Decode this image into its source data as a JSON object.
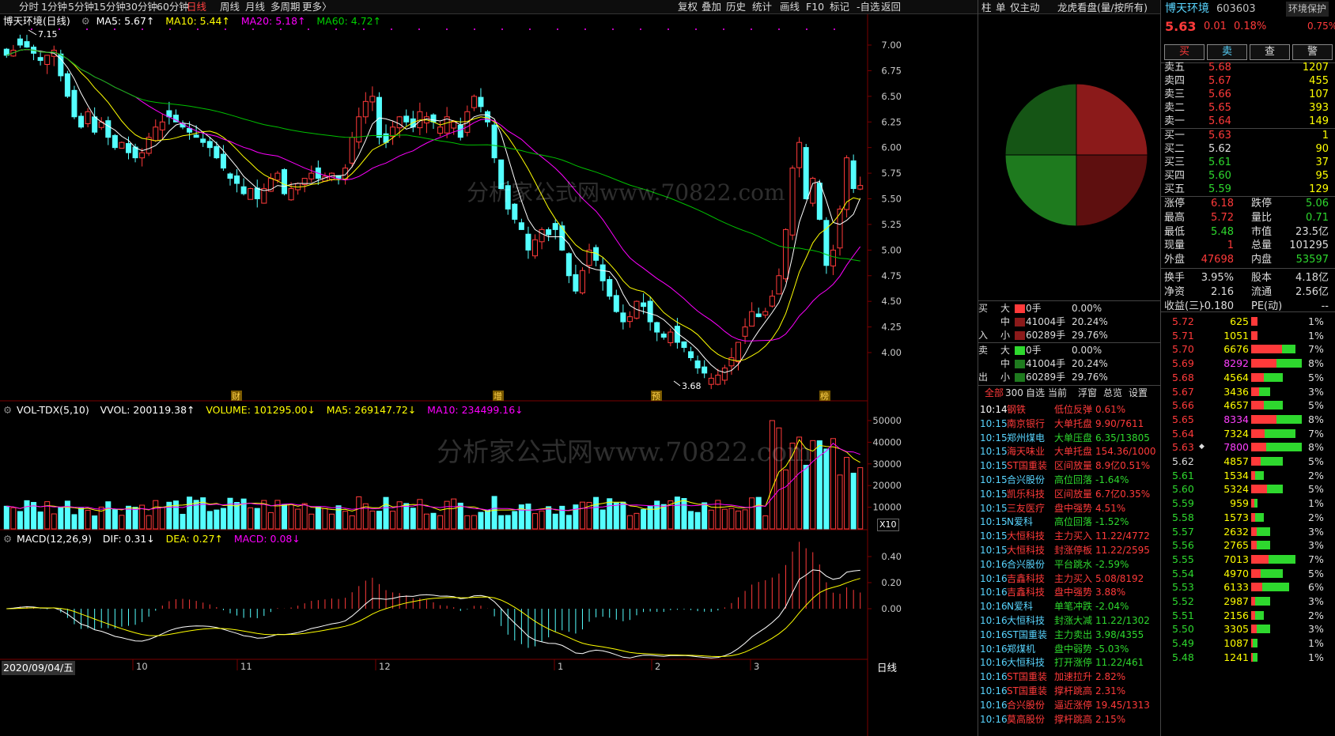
{
  "colors": {
    "up": "#ff3a3a",
    "down": "#54ffff",
    "ma5": "#ffffff",
    "ma10": "#ffff00",
    "ma20": "#ff00ff",
    "ma60": "#00c000",
    "pie_red": "#8b1a1a",
    "pie_green": "#1e7a1e"
  },
  "timeframe_tabs": [
    "分时",
    "1分钟",
    "5分钟",
    "15分钟",
    "30分钟",
    "60分钟",
    "日线",
    "周线",
    "月线",
    "多周期",
    "更多〉"
  ],
  "active_tab": "日线",
  "toolbar": [
    "复权",
    "叠加",
    "历史",
    "统计",
    "画线",
    "F10",
    "标记",
    "-自选",
    "返回"
  ],
  "mid_tabs": [
    "柱",
    "单",
    "仅主动"
  ],
  "dragon_tiger": "龙虎看盘(量/按所有)",
  "price_header": {
    "name": "博天环境(日线)",
    "ma5": "MA5: 5.67↑",
    "ma10": "MA10: 5.44↑",
    "ma20": "MA20: 5.18↑",
    "ma60": "MA60: 4.72↑"
  },
  "high_marker": "7.15",
  "low_marker": "3.68",
  "price_axis": [
    "7.00",
    "6.75",
    "6.50",
    "6.25",
    "6.00",
    "5.75",
    "5.50",
    "5.25",
    "5.00",
    "4.75",
    "4.50",
    "4.25",
    "4.00"
  ],
  "event_markers": [
    "财",
    "增",
    "预",
    "榜"
  ],
  "vol_header": {
    "name": "VOL-TDX(5,10)",
    "vvol": "VVOL: 200119.38↑",
    "volume": "VOLUME: 101295.00↓",
    "ma5": "MA5: 269147.72↓",
    "ma10": "MA10: 234499.16↓"
  },
  "vol_axis": [
    "50000",
    "40000",
    "30000",
    "20000",
    "10000"
  ],
  "vol_unit": "X10",
  "macd_header": {
    "name": "MACD(12,26,9)",
    "dif": "DIF: 0.31↓",
    "dea": "DEA: 0.27↑",
    "macd": "MACD: 0.08↓"
  },
  "macd_axis": [
    "0.40",
    "0.20",
    "0.00"
  ],
  "date_axis": {
    "first": "2020/09/04/五",
    "labels": [
      "10",
      "11",
      "12",
      "1",
      "2",
      "3"
    ]
  },
  "period_label": "日线",
  "watermark": "分析家公式网www.70822.com",
  "stock": {
    "name": "博天环境",
    "code": "603603",
    "tag": "环境保护",
    "price": "5.63",
    "change": "0.01",
    "pct": "0.18%",
    "turnover_tag": "0.75%"
  },
  "action_buttons": [
    "买",
    "卖",
    "查",
    "警"
  ],
  "asks": [
    {
      "label": "卖五",
      "price": "5.68",
      "vol": "1207"
    },
    {
      "label": "卖四",
      "price": "5.67",
      "vol": "455"
    },
    {
      "label": "卖三",
      "price": "5.66",
      "vol": "107"
    },
    {
      "label": "卖二",
      "price": "5.65",
      "vol": "393"
    },
    {
      "label": "卖一",
      "price": "5.64",
      "vol": "149"
    }
  ],
  "bids": [
    {
      "label": "买一",
      "price": "5.63",
      "vol": "1"
    },
    {
      "label": "买二",
      "price": "5.62",
      "vol": "90"
    },
    {
      "label": "买三",
      "price": "5.61",
      "vol": "37"
    },
    {
      "label": "买四",
      "price": "5.60",
      "vol": "95"
    },
    {
      "label": "买五",
      "price": "5.59",
      "vol": "129"
    }
  ],
  "stats": [
    {
      "l1": "涨停",
      "v1": "6.18",
      "l2": "跌停",
      "v2": "5.06"
    },
    {
      "l1": "最高",
      "v1": "5.72",
      "l2": "量比",
      "v2": "0.71"
    },
    {
      "l1": "最低",
      "v1": "5.48",
      "l2": "市值",
      "v2": "23.5亿"
    },
    {
      "l1": "现量",
      "v1": "1",
      "l2": "总量",
      "v2": "101295"
    },
    {
      "l1": "外盘",
      "v1": "47698",
      "l2": "内盘",
      "v2": "53597"
    },
    {
      "l1": "换手",
      "v1": "3.95%",
      "l2": "股本",
      "v2": "4.18亿"
    },
    {
      "l1": "净资",
      "v1": "2.16",
      "l2": "流通",
      "v2": "2.56亿"
    },
    {
      "l1": "收益(三)",
      "v1": "-0.180",
      "l2": "PE(动)",
      "v2": "--"
    }
  ],
  "flow": {
    "buy_group": "买入",
    "sell_group": "卖出",
    "buy": [
      {
        "size": "大",
        "qty": "0手",
        "pct": "0.00%"
      },
      {
        "size": "中",
        "qty": "41004手",
        "pct": "20.24%"
      },
      {
        "size": "小",
        "qty": "60289手",
        "pct": "29.76%"
      }
    ],
    "sell": [
      {
        "size": "大",
        "qty": "0手",
        "pct": "0.00%"
      },
      {
        "size": "中",
        "qty": "41004手",
        "pct": "20.24%"
      },
      {
        "size": "小",
        "qty": "60289手",
        "pct": "29.76%"
      }
    ],
    "pie": [
      {
        "pct": 25.0,
        "color": "#8b1a1a"
      },
      {
        "pct": 25.0,
        "color": "#5e0f0f"
      },
      {
        "pct": 25.0,
        "color": "#1e7a1e"
      },
      {
        "pct": 25.0,
        "color": "#155515"
      }
    ]
  },
  "news_tabs": [
    "全部",
    "300",
    "自选",
    "当前",
    "浮窗",
    "总览",
    "设置"
  ],
  "news": [
    {
      "t": "10:14",
      "n": "钢铁",
      "e": "低位反弹",
      "v": "0.61%",
      "c": "r"
    },
    {
      "t": "10:15",
      "n": "南京银行",
      "e": "大单托盘",
      "v": "9.90/7611",
      "c": "r"
    },
    {
      "t": "10:15",
      "n": "郑州煤电",
      "e": "大单压盘",
      "v": "6.35/13805",
      "c": "g"
    },
    {
      "t": "10:15",
      "n": "海天味业",
      "e": "大单托盘",
      "v": "154.36/1000",
      "c": "r"
    },
    {
      "t": "10:15",
      "n": "ST国重装",
      "e": "区间放量",
      "v": "8.9亿0.51%",
      "c": "r"
    },
    {
      "t": "10:15",
      "n": "合兴股份",
      "e": "高位回落",
      "v": "-1.64%",
      "c": "g"
    },
    {
      "t": "10:15",
      "n": "凯乐科技",
      "e": "区间放量",
      "v": "6.7亿0.35%",
      "c": "r"
    },
    {
      "t": "10:15",
      "n": "三友医疗",
      "e": "盘中强势",
      "v": "4.51%",
      "c": "r"
    },
    {
      "t": "10:15",
      "n": "N爱科",
      "e": "高位回落",
      "v": "-1.52%",
      "c": "g"
    },
    {
      "t": "10:15",
      "n": "大恒科技",
      "e": "主力买入",
      "v": "11.22/4772",
      "c": "r"
    },
    {
      "t": "10:15",
      "n": "大恒科技",
      "e": "封涨停板",
      "v": "11.22/2595",
      "c": "r"
    },
    {
      "t": "10:16",
      "n": "合兴股份",
      "e": "平台跳水",
      "v": "-2.59%",
      "c": "g"
    },
    {
      "t": "10:16",
      "n": "吉鑫科技",
      "e": "主力买入",
      "v": "5.08/8192",
      "c": "r"
    },
    {
      "t": "10:16",
      "n": "吉鑫科技",
      "e": "盘中强势",
      "v": "3.88%",
      "c": "r"
    },
    {
      "t": "10:16",
      "n": "N爱科",
      "e": "单笔冲跌",
      "v": "-2.04%",
      "c": "g"
    },
    {
      "t": "10:16",
      "n": "大恒科技",
      "e": "封涨大减",
      "v": "11.22/1302",
      "c": "g"
    },
    {
      "t": "10:16",
      "n": "ST国重装",
      "e": "主力卖出",
      "v": "3.98/4355",
      "c": "g"
    },
    {
      "t": "10:16",
      "n": "郑煤机",
      "e": "盘中弱势",
      "v": "-5.03%",
      "c": "g"
    },
    {
      "t": "10:16",
      "n": "大恒科技",
      "e": "打开涨停",
      "v": "11.22/461",
      "c": "g"
    },
    {
      "t": "10:16",
      "n": "ST国重装",
      "e": "加速拉升",
      "v": "2.82%",
      "c": "r"
    },
    {
      "t": "10:16",
      "n": "ST国重装",
      "e": "撑杆跳高",
      "v": "2.31%",
      "c": "r"
    },
    {
      "t": "10:16",
      "n": "合兴股份",
      "e": "逼近涨停",
      "v": "19.45/1313",
      "c": "r"
    },
    {
      "t": "10:16",
      "n": "莫高股份",
      "e": "撑杆跳高",
      "v": "2.15%",
      "c": "r"
    }
  ],
  "price_ladder": [
    {
      "p": "5.72",
      "v": "625",
      "pct": "1%",
      "r": 1.0,
      "g": 0.0,
      "c": "r"
    },
    {
      "p": "5.71",
      "v": "1051",
      "pct": "1%",
      "r": 1.0,
      "g": 0.0,
      "c": "r"
    },
    {
      "p": "5.70",
      "v": "6676",
      "pct": "7%",
      "r": 0.7,
      "g": 0.3,
      "c": "r"
    },
    {
      "p": "5.69",
      "v": "8292",
      "pct": "8%",
      "r": 0.5,
      "g": 0.5,
      "c": "r",
      "vc": "m"
    },
    {
      "p": "5.68",
      "v": "4564",
      "pct": "5%",
      "r": 0.4,
      "g": 0.6,
      "c": "r"
    },
    {
      "p": "5.67",
      "v": "3436",
      "pct": "3%",
      "r": 0.4,
      "g": 0.6,
      "c": "r"
    },
    {
      "p": "5.66",
      "v": "4657",
      "pct": "5%",
      "r": 0.4,
      "g": 0.6,
      "c": "r"
    },
    {
      "p": "5.65",
      "v": "8334",
      "pct": "8%",
      "r": 0.5,
      "g": 0.5,
      "c": "r",
      "vc": "m"
    },
    {
      "p": "5.64",
      "v": "7324",
      "pct": "7%",
      "r": 0.3,
      "g": 0.7,
      "c": "r"
    },
    {
      "p": "5.63",
      "v": "7800",
      "pct": "8%",
      "r": 0.3,
      "g": 0.7,
      "c": "r",
      "vc": "m",
      "mark": "◆"
    },
    {
      "p": "5.62",
      "v": "4857",
      "pct": "5%",
      "r": 0.3,
      "g": 0.7,
      "c": "w"
    },
    {
      "p": "5.61",
      "v": "1534",
      "pct": "2%",
      "r": 0.3,
      "g": 0.7,
      "c": "g"
    },
    {
      "p": "5.60",
      "v": "5324",
      "pct": "5%",
      "r": 0.5,
      "g": 0.5,
      "c": "g"
    },
    {
      "p": "5.59",
      "v": "959",
      "pct": "1%",
      "r": 0.5,
      "g": 0.5,
      "c": "g"
    },
    {
      "p": "5.58",
      "v": "1573",
      "pct": "2%",
      "r": 0.3,
      "g": 0.7,
      "c": "g"
    },
    {
      "p": "5.57",
      "v": "2632",
      "pct": "3%",
      "r": 0.3,
      "g": 0.7,
      "c": "g"
    },
    {
      "p": "5.56",
      "v": "2765",
      "pct": "3%",
      "r": 0.3,
      "g": 0.7,
      "c": "g"
    },
    {
      "p": "5.55",
      "v": "7013",
      "pct": "7%",
      "r": 0.4,
      "g": 0.6,
      "c": "g"
    },
    {
      "p": "5.54",
      "v": "4970",
      "pct": "5%",
      "r": 0.3,
      "g": 0.7,
      "c": "g"
    },
    {
      "p": "5.53",
      "v": "6133",
      "pct": "6%",
      "r": 0.3,
      "g": 0.7,
      "c": "g"
    },
    {
      "p": "5.52",
      "v": "2987",
      "pct": "3%",
      "r": 0.2,
      "g": 0.8,
      "c": "g"
    },
    {
      "p": "5.51",
      "v": "2156",
      "pct": "2%",
      "r": 0.3,
      "g": 0.7,
      "c": "g"
    },
    {
      "p": "5.50",
      "v": "3305",
      "pct": "3%",
      "r": 0.3,
      "g": 0.7,
      "c": "g"
    },
    {
      "p": "5.49",
      "v": "1087",
      "pct": "1%",
      "r": 0.3,
      "g": 0.7,
      "c": "g"
    },
    {
      "p": "5.48",
      "v": "1241",
      "pct": "1%",
      "r": 0.3,
      "g": 0.7,
      "c": "g"
    }
  ],
  "chart_data": {
    "type": "candlestick",
    "series": "daily OHLC (approx.)",
    "closes": [
      6.9,
      6.95,
      7.0,
      6.98,
      6.92,
      6.85,
      6.9,
      6.95,
      6.7,
      6.5,
      6.3,
      6.2,
      6.35,
      6.15,
      6.25,
      6.1,
      6.0,
      6.05,
      5.95,
      5.9,
      5.95,
      6.1,
      6.2,
      6.25,
      6.3,
      6.25,
      6.2,
      6.15,
      6.1,
      6.05,
      6.0,
      5.9,
      5.8,
      5.7,
      5.65,
      5.55,
      5.6,
      5.5,
      5.6,
      5.7,
      5.75,
      5.55,
      5.6,
      5.65,
      5.7,
      5.75,
      5.7,
      5.72,
      5.75,
      5.7,
      5.8,
      6.1,
      6.3,
      6.45,
      6.5,
      6.1,
      6.05,
      6.2,
      6.3,
      6.25,
      6.2,
      6.35,
      6.3,
      6.25,
      6.2,
      6.3,
      6.25,
      6.1,
      6.35,
      6.5,
      6.4,
      6.25,
      5.9,
      5.6,
      5.4,
      5.3,
      5.2,
      5.0,
      5.1,
      5.2,
      5.15,
      5.2,
      5.0,
      4.75,
      4.6,
      4.8,
      5.0,
      4.9,
      4.7,
      4.55,
      4.4,
      4.3,
      4.35,
      4.5,
      4.45,
      4.3,
      4.2,
      4.15,
      4.2,
      4.1,
      4.05,
      3.95,
      3.85,
      3.8,
      3.75,
      3.78,
      3.85,
      3.95,
      4.1,
      4.25,
      4.4,
      4.35,
      4.4,
      4.55,
      4.75,
      5.2,
      5.8,
      6.05,
      5.5,
      5.7,
      5.3,
      4.85,
      5.0,
      5.4,
      5.9,
      5.6,
      5.63
    ]
  }
}
